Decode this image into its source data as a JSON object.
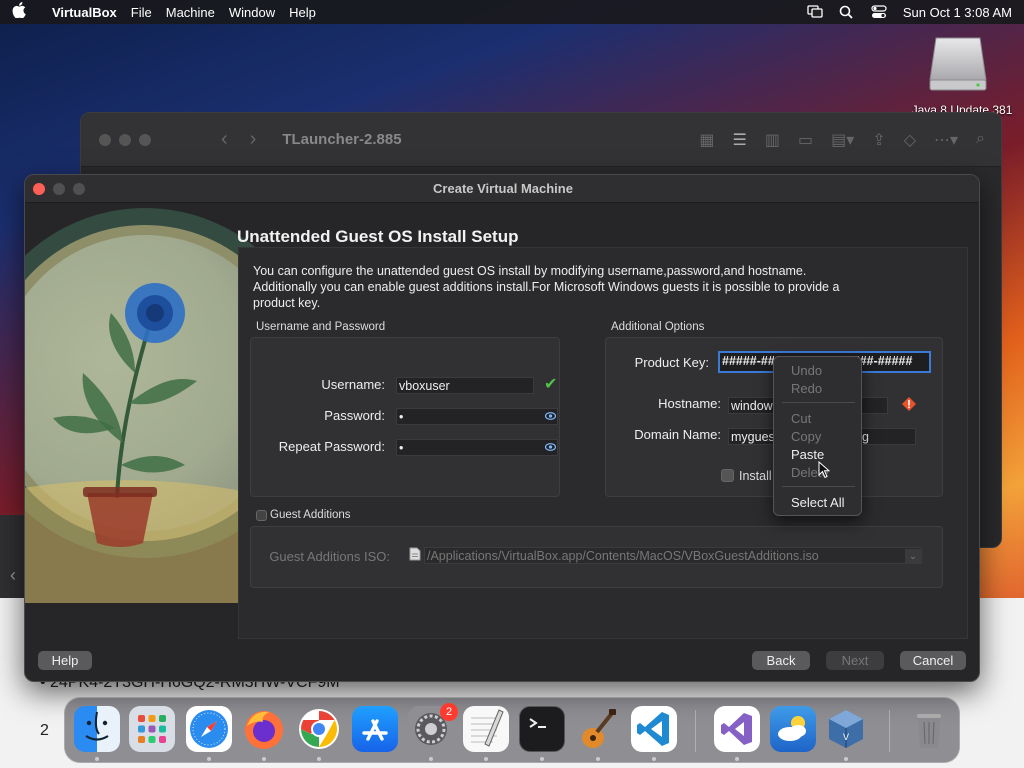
{
  "menubar": {
    "app_name": "VirtualBox",
    "items": [
      "File",
      "Machine",
      "Window",
      "Help"
    ],
    "datetime": "Sun Oct 1  3:08 AM"
  },
  "desktop": {
    "drive_label": "Java 8 Update 381"
  },
  "finder": {
    "title": "TLauncher-2.885"
  },
  "background_doc": {
    "line1": "24PK4-2T3GH-H6GQ2-RM3HW-VCF9M",
    "line2": "2"
  },
  "dialog": {
    "title": "Create Virtual Machine",
    "page_title": "Unattended Guest OS Install Setup",
    "description": "You can configure the unattended guest OS install by modifying username,password,and hostname. Additionally you can enable guest additions install.For Microsoft Windows guests it is possible to provide a product key.",
    "username_group": {
      "label": "Username and Password",
      "username_label": "Username:",
      "username_value": "vboxuser",
      "password_label": "Password:",
      "password_value": "•",
      "repeat_label": "Repeat Password:",
      "repeat_value": "•"
    },
    "options_group": {
      "label": "Additional Options",
      "product_key_label": "Product Key:",
      "product_key_value": "#####-#####-#####-#####-#####",
      "hostname_label": "Hostname:",
      "hostname_value": "window",
      "domain_label": "Domain Name:",
      "domain_value": "mygues",
      "domain_suffix": "g",
      "install_label": "Install"
    },
    "guest_additions": {
      "label": "Guest Additions",
      "iso_label": "Guest Additions ISO:",
      "iso_value": "/Applications/VirtualBox.app/Contents/MacOS/VBoxGuestAdditions.iso"
    },
    "buttons": {
      "help": "Help",
      "back": "Back",
      "next": "Next",
      "cancel": "Cancel"
    }
  },
  "context_menu": {
    "undo": "Undo",
    "redo": "Redo",
    "cut": "Cut",
    "copy": "Copy",
    "paste": "Paste",
    "delete": "Delete",
    "select_all": "Select All"
  },
  "dock": {
    "settings_badge": "2"
  },
  "colors": {
    "accent": "#3a7ad9",
    "success": "#4fc24a",
    "warning": "#e8532c",
    "close": "#fe5f57"
  }
}
